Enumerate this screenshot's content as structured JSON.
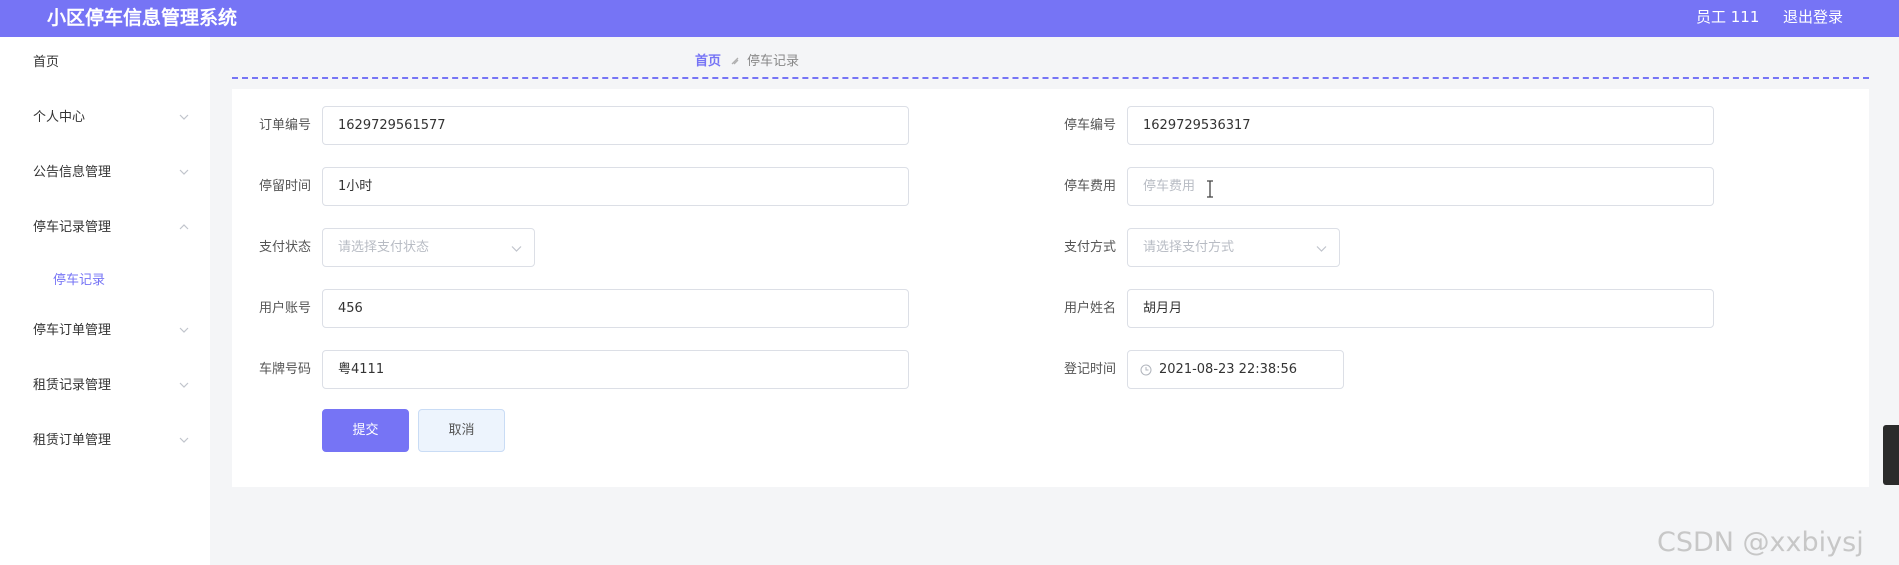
{
  "header": {
    "title": "小区停车信息管理系统",
    "user": "员工 111",
    "logout": "退出登录"
  },
  "sidebar": {
    "items": [
      {
        "label": "首页"
      },
      {
        "label": "个人中心"
      },
      {
        "label": "公告信息管理"
      },
      {
        "label": "停车记录管理"
      },
      {
        "label": "停车记录"
      },
      {
        "label": "停车订单管理"
      },
      {
        "label": "租赁记录管理"
      },
      {
        "label": "租赁订单管理"
      }
    ]
  },
  "breadcrumb": {
    "home": "首页",
    "current": "停车记录"
  },
  "form": {
    "order_no": {
      "label": "订单编号",
      "value": "1629729561577"
    },
    "parking_no": {
      "label": "停车编号",
      "value": "1629729536317"
    },
    "duration": {
      "label": "停留时间",
      "value": "1小时"
    },
    "fee": {
      "label": "停车费用",
      "placeholder": "停车费用"
    },
    "pay_status": {
      "label": "支付状态",
      "placeholder": "请选择支付状态"
    },
    "pay_method": {
      "label": "支付方式",
      "placeholder": "请选择支付方式"
    },
    "user_account": {
      "label": "用户账号",
      "value": "456"
    },
    "user_name": {
      "label": "用户姓名",
      "value": "胡月月"
    },
    "plate_no": {
      "label": "车牌号码",
      "value": "粤4111"
    },
    "register_time": {
      "label": "登记时间",
      "value": "2021-08-23 22:38:56"
    }
  },
  "buttons": {
    "submit": "提交",
    "cancel": "取消"
  },
  "watermark": "CSDN @xxbiysj",
  "colors": {
    "accent": "#7674f5",
    "border": "#dcdfe6",
    "placeholder": "#b8bcc4"
  }
}
